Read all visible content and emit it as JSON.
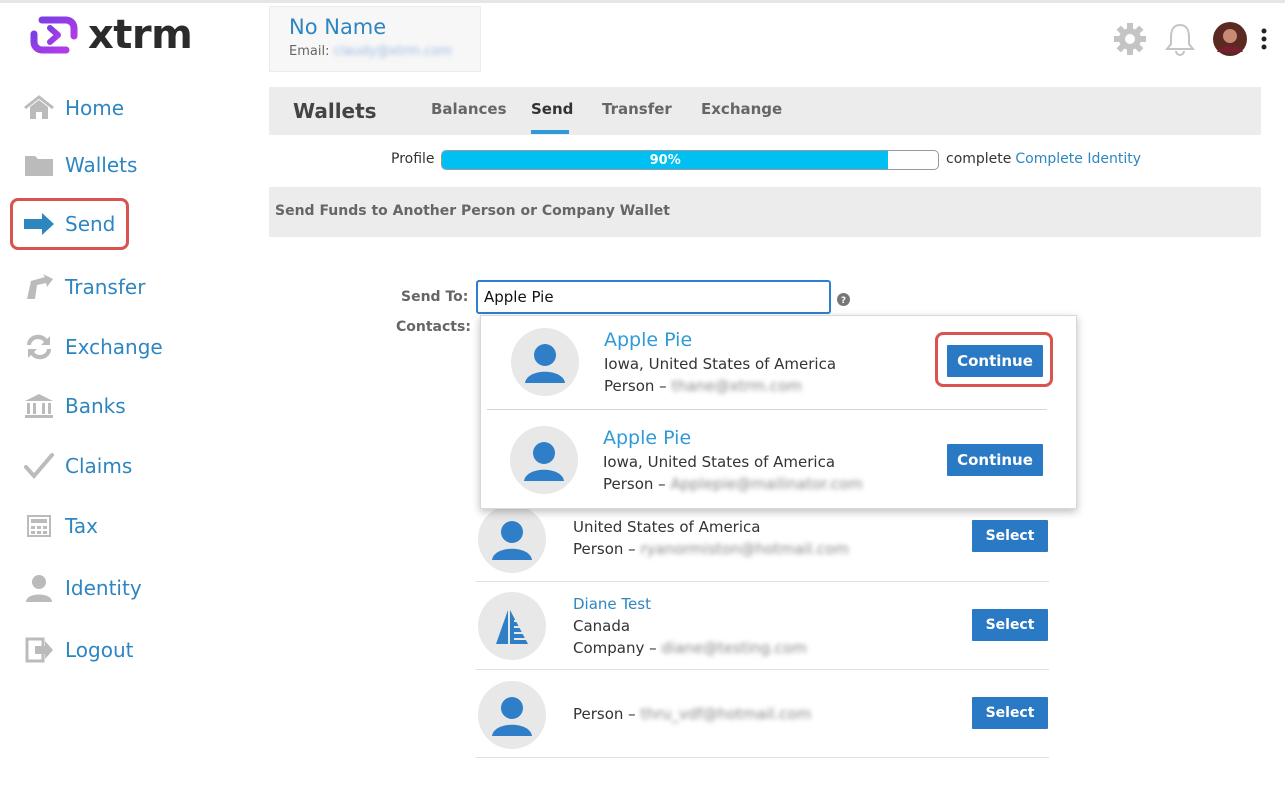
{
  "app": {
    "logo_text": "xtrm"
  },
  "account": {
    "name": "No Name",
    "email_label": "Email:",
    "email_value": "claudy@xtrm.com"
  },
  "sidebar": {
    "items": [
      {
        "label": "Home",
        "icon": "home-icon"
      },
      {
        "label": "Wallets",
        "icon": "folder-icon"
      },
      {
        "label": "Send",
        "icon": "send-arrow-icon"
      },
      {
        "label": "Transfer",
        "icon": "transfer-icon"
      },
      {
        "label": "Exchange",
        "icon": "exchange-icon"
      },
      {
        "label": "Banks",
        "icon": "bank-icon"
      },
      {
        "label": "Claims",
        "icon": "checkmark-icon"
      },
      {
        "label": "Tax",
        "icon": "calculator-icon"
      },
      {
        "label": "Identity",
        "icon": "person-icon"
      },
      {
        "label": "Logout",
        "icon": "logout-icon"
      }
    ]
  },
  "header_icons": [
    "gear-icon",
    "bell-icon",
    "avatar",
    "more-vertical-icon"
  ],
  "tabs": {
    "title": "Wallets",
    "items": [
      {
        "label": "Balances"
      },
      {
        "label": "Send"
      },
      {
        "label": "Transfer"
      },
      {
        "label": "Exchange"
      }
    ],
    "active": "Send"
  },
  "profile": {
    "label": "Profile",
    "percent_text": "90%",
    "fraction": 0.9,
    "complete_text": "complete",
    "complete_link": "Complete Identity"
  },
  "section_title": "Send Funds to Another Person or Company Wallet",
  "send_to": {
    "label": "Send To:",
    "value": "Apple Pie",
    "contacts_label": "Contacts:"
  },
  "dropdown": [
    {
      "name": "Apple Pie",
      "location": "Iowa, United States of America",
      "type": "Person –",
      "email": "thane@xtrm.com",
      "button": "Continue"
    },
    {
      "name": "Apple Pie",
      "location": "Iowa, United States of America",
      "type": "Person –",
      "email": "Applepie@mailinator.com",
      "button": "Continue"
    }
  ],
  "contacts": [
    {
      "name": "",
      "location": "United States of America",
      "type": "Person –",
      "email": "ryanormiston@hotmail.com",
      "button": "Select",
      "avatar": "person-avatar-icon"
    },
    {
      "name": "Diane Test",
      "location": "Canada",
      "type": "Company –",
      "email": "diane@testing.com",
      "button": "Select",
      "avatar": "company-avatar-icon"
    },
    {
      "name": "",
      "location": "",
      "type": "Person –",
      "email": "thru_vdf@hotmail.com",
      "button": "Select",
      "avatar": "person-avatar-icon"
    }
  ],
  "colors": {
    "accent": "#2e86c1",
    "button": "#2a79c4",
    "progress": "#00bff3",
    "highlight": "#d9534f"
  }
}
